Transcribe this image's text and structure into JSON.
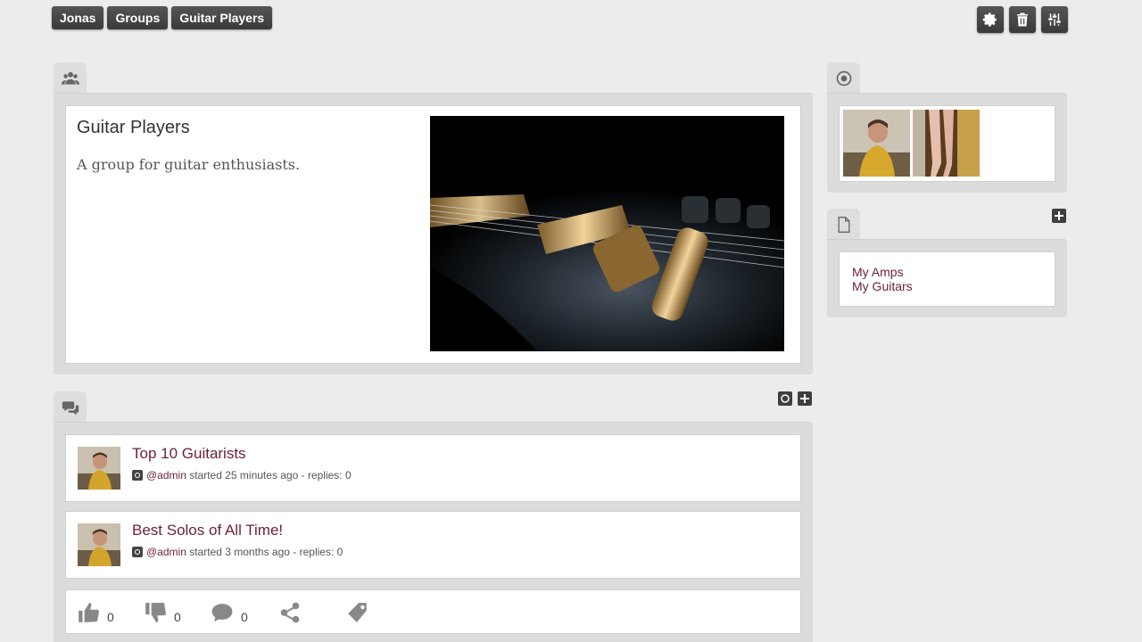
{
  "breadcrumbs": [
    "Jonas",
    "Groups",
    "Guitar Players"
  ],
  "tools": {
    "settings_icon": "gear-icon",
    "delete_icon": "trash-icon",
    "adjust_icon": "sliders-icon"
  },
  "group": {
    "title": "Guitar Players",
    "description": "A group for guitar enthusiasts.",
    "image_alt": "Close-up of an electric guitar bridge and pickups"
  },
  "discussions": [
    {
      "title": "Top 10 Guitarists",
      "author": "@admin",
      "meta": "started 25 minutes ago - replies: 0"
    },
    {
      "title": "Best Solos of All Time!",
      "author": "@admin",
      "meta": "started 3 months ago - replies: 0"
    }
  ],
  "actions": {
    "likes": "0",
    "dislikes": "0",
    "comments": "0"
  },
  "pages": [
    "My Amps",
    "My Guitars"
  ],
  "colors": {
    "link": "#6b1f3a",
    "button": "#3f3f3f",
    "panel": "#dcdcdc",
    "background": "#ececec"
  }
}
